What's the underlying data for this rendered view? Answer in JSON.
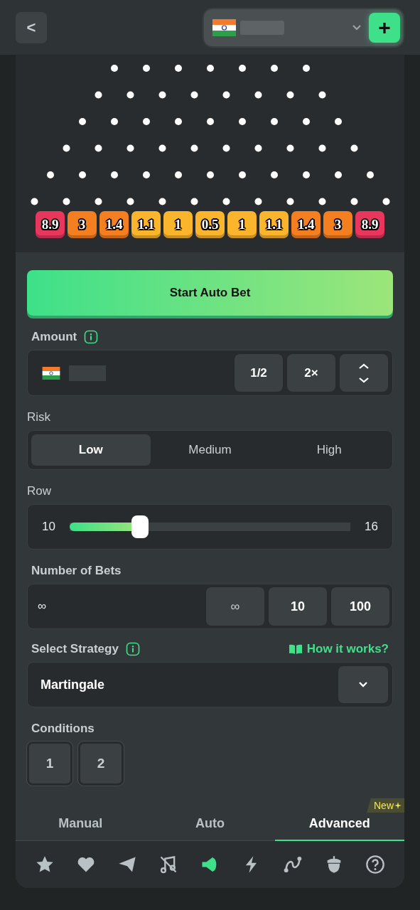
{
  "header": {
    "back": "<",
    "add": "+"
  },
  "board": {
    "slots": [
      {
        "label": "8.9",
        "color": "#e8365d"
      },
      {
        "label": "3",
        "color": "#f47f20"
      },
      {
        "label": "1.4",
        "color": "#f47f20"
      },
      {
        "label": "1.1",
        "color": "#fbb52c"
      },
      {
        "label": "1",
        "color": "#fbb52c"
      },
      {
        "label": "0.5",
        "color": "#fbb52c"
      },
      {
        "label": "1",
        "color": "#fbb52c"
      },
      {
        "label": "1.1",
        "color": "#fbb52c"
      },
      {
        "label": "1.4",
        "color": "#f47f20"
      },
      {
        "label": "3",
        "color": "#f47f20"
      },
      {
        "label": "8.9",
        "color": "#e8365d"
      }
    ]
  },
  "start_button": "Start Auto Bet",
  "amount": {
    "label": "Amount",
    "buttons": [
      "1/2",
      "2×"
    ]
  },
  "risk": {
    "label": "Risk",
    "options": [
      {
        "label": "Low",
        "selected": true
      },
      {
        "label": "Medium",
        "selected": false
      },
      {
        "label": "High",
        "selected": false
      }
    ]
  },
  "row": {
    "label": "Row",
    "min": "10",
    "max": "16",
    "level": 0.25
  },
  "number_of_bets": {
    "label": "Number of Bets",
    "value": "∞",
    "buttons": [
      "∞",
      "10",
      "100"
    ]
  },
  "strategy": {
    "label": "Select Strategy",
    "link": "How it works?",
    "value": "Martingale"
  },
  "conditions": {
    "label": "Conditions",
    "buttons": [
      "1",
      "2"
    ]
  },
  "tabs": [
    {
      "label": "Manual",
      "selected": false
    },
    {
      "label": "Auto",
      "selected": false
    },
    {
      "label": "Advanced",
      "selected": true,
      "badge": "New"
    }
  ],
  "bottom_bar": [
    {
      "active": false
    },
    {
      "active": false
    },
    {
      "active": false
    },
    {
      "active": false
    },
    {
      "active": true
    },
    {
      "active": false
    },
    {
      "active": false
    },
    {
      "active": false
    },
    {
      "active": false
    }
  ]
}
